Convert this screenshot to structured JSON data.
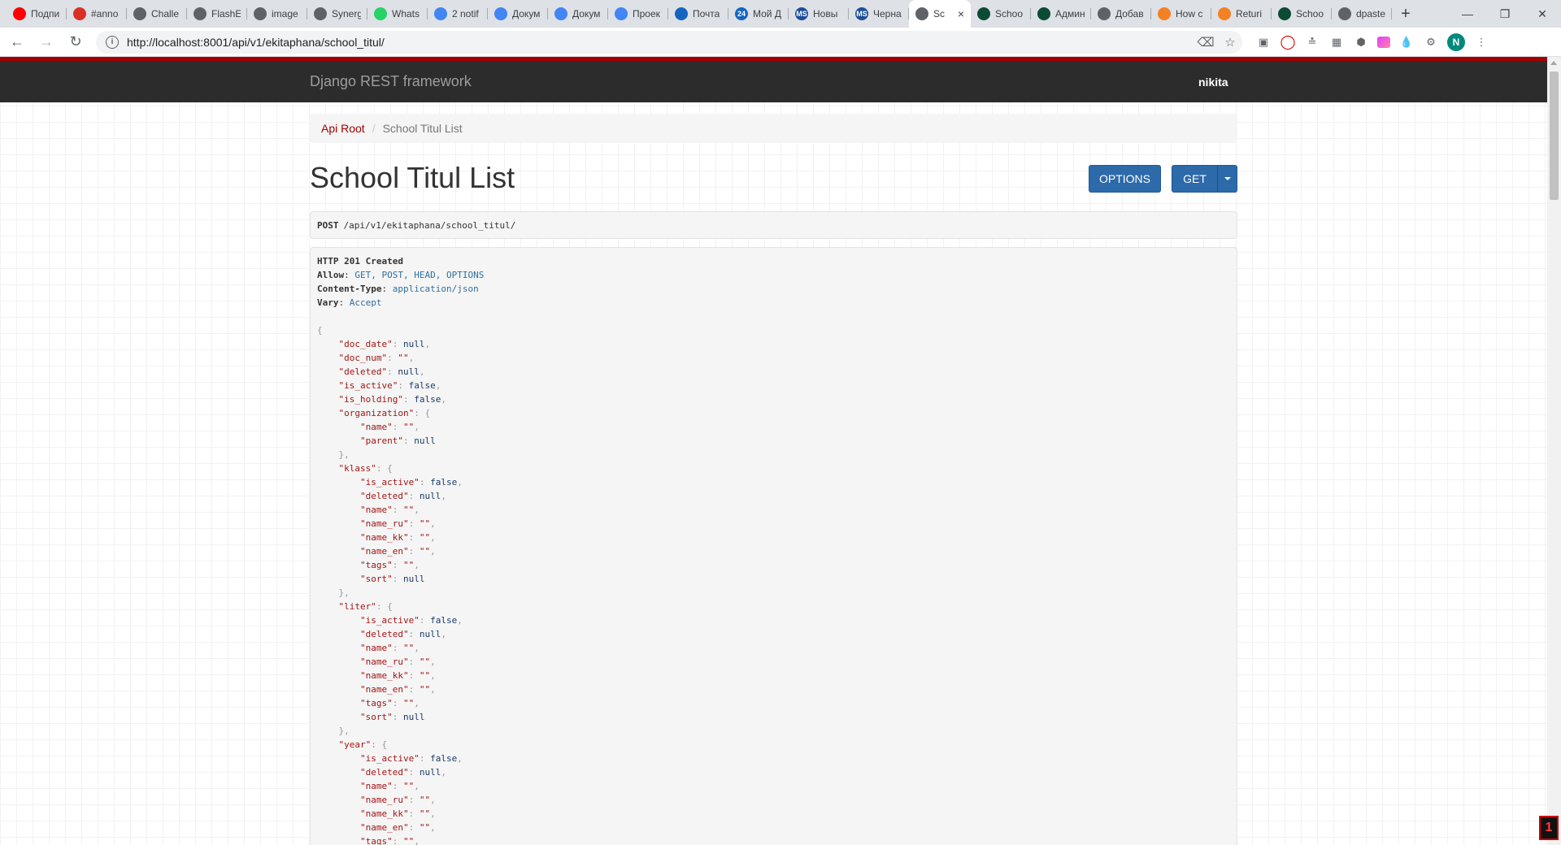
{
  "browser": {
    "tabs": [
      {
        "title": "Подпи",
        "favicon": "youtube-icon",
        "color": "#ff0000"
      },
      {
        "title": "#anno",
        "favicon": "gmail-icon",
        "color": "#d93025"
      },
      {
        "title": "Challe",
        "favicon": "globe-icon",
        "color": "#5f6368"
      },
      {
        "title": "FlashE",
        "favicon": "globe-icon",
        "color": "#5f6368"
      },
      {
        "title": "image",
        "favicon": "globe-icon",
        "color": "#5f6368"
      },
      {
        "title": "Synerg",
        "favicon": "globe-icon",
        "color": "#5f6368"
      },
      {
        "title": "Whats",
        "favicon": "whatsapp-icon",
        "color": "#25d366"
      },
      {
        "title": "2 notif",
        "favicon": "chat-icon",
        "color": "#4285f4"
      },
      {
        "title": "Докум",
        "favicon": "docs-icon",
        "color": "#4285f4"
      },
      {
        "title": "Докум",
        "favicon": "docs-icon",
        "color": "#4285f4"
      },
      {
        "title": "Проек",
        "favicon": "docs-icon",
        "color": "#4285f4"
      },
      {
        "title": "Почта",
        "favicon": "mail-icon",
        "color": "#1565c0"
      },
      {
        "title": "Мой Д",
        "favicon": "calendar-icon",
        "color": "#1565c0",
        "badge": "24"
      },
      {
        "title": "Новы",
        "favicon": "ms-icon",
        "color": "#1e4e9a",
        "badge": "MS"
      },
      {
        "title": "Черна",
        "favicon": "ms-icon",
        "color": "#1e4e9a",
        "badge": "MS"
      },
      {
        "title": "Sc",
        "favicon": "globe-icon",
        "color": "#5f6368",
        "active": true
      },
      {
        "title": "Schoo",
        "favicon": "django-icon",
        "color": "#0c4b33"
      },
      {
        "title": "Админ",
        "favicon": "django-icon",
        "color": "#0c4b33"
      },
      {
        "title": "Добав",
        "favicon": "globe-icon",
        "color": "#5f6368"
      },
      {
        "title": "How c",
        "favicon": "stackoverflow-icon",
        "color": "#f48024"
      },
      {
        "title": "Returi",
        "favicon": "stackoverflow-icon",
        "color": "#f48024"
      },
      {
        "title": "Schoo",
        "favicon": "django-icon",
        "color": "#0c4b33"
      },
      {
        "title": "dpaste",
        "favicon": "globe-icon",
        "color": "#5f6368"
      }
    ],
    "new_tab_label": "+",
    "url": "http://localhost:8001/api/v1/ekitaphana/school_titul/",
    "avatar_letter": "N",
    "corner_badge": "1"
  },
  "navbar": {
    "brand": "Django REST framework",
    "user": "nikita"
  },
  "breadcrumb": {
    "root": "Api Root",
    "current": "School Titul List"
  },
  "page": {
    "title": "School Titul List",
    "options_label": "OPTIONS",
    "get_label": "GET"
  },
  "request": {
    "method": "POST",
    "path": "/api/v1/ekitaphana/school_titul/"
  },
  "response": {
    "status": "HTTP 201 Created",
    "headers": [
      {
        "key": "Allow",
        "value": "GET, POST, HEAD, OPTIONS"
      },
      {
        "key": "Content-Type",
        "value": "application/json"
      },
      {
        "key": "Vary",
        "value": "Accept"
      }
    ],
    "body_lines": [
      [
        0,
        "{",
        "",
        ""
      ],
      [
        1,
        "\"doc_date\"",
        "null",
        ","
      ],
      [
        1,
        "\"doc_num\"",
        "\"\"",
        ","
      ],
      [
        1,
        "\"deleted\"",
        "null",
        ","
      ],
      [
        1,
        "\"is_active\"",
        "false",
        ","
      ],
      [
        1,
        "\"is_holding\"",
        "false",
        ","
      ],
      [
        1,
        "\"organization\"",
        "{",
        ""
      ],
      [
        2,
        "\"name\"",
        "\"\"",
        ","
      ],
      [
        2,
        "\"parent\"",
        "null",
        ""
      ],
      [
        1,
        "},",
        "",
        ""
      ],
      [
        1,
        "\"klass\"",
        "{",
        ""
      ],
      [
        2,
        "\"is_active\"",
        "false",
        ","
      ],
      [
        2,
        "\"deleted\"",
        "null",
        ","
      ],
      [
        2,
        "\"name\"",
        "\"\"",
        ","
      ],
      [
        2,
        "\"name_ru\"",
        "\"\"",
        ","
      ],
      [
        2,
        "\"name_kk\"",
        "\"\"",
        ","
      ],
      [
        2,
        "\"name_en\"",
        "\"\"",
        ","
      ],
      [
        2,
        "\"tags\"",
        "\"\"",
        ","
      ],
      [
        2,
        "\"sort\"",
        "null",
        ""
      ],
      [
        1,
        "},",
        "",
        ""
      ],
      [
        1,
        "\"liter\"",
        "{",
        ""
      ],
      [
        2,
        "\"is_active\"",
        "false",
        ","
      ],
      [
        2,
        "\"deleted\"",
        "null",
        ","
      ],
      [
        2,
        "\"name\"",
        "\"\"",
        ","
      ],
      [
        2,
        "\"name_ru\"",
        "\"\"",
        ","
      ],
      [
        2,
        "\"name_kk\"",
        "\"\"",
        ","
      ],
      [
        2,
        "\"name_en\"",
        "\"\"",
        ","
      ],
      [
        2,
        "\"tags\"",
        "\"\"",
        ","
      ],
      [
        2,
        "\"sort\"",
        "null",
        ""
      ],
      [
        1,
        "},",
        "",
        ""
      ],
      [
        1,
        "\"year\"",
        "{",
        ""
      ],
      [
        2,
        "\"is_active\"",
        "false",
        ","
      ],
      [
        2,
        "\"deleted\"",
        "null",
        ","
      ],
      [
        2,
        "\"name\"",
        "\"\"",
        ","
      ],
      [
        2,
        "\"name_ru\"",
        "\"\"",
        ","
      ],
      [
        2,
        "\"name_kk\"",
        "\"\"",
        ","
      ],
      [
        2,
        "\"name_en\"",
        "\"\"",
        ","
      ],
      [
        2,
        "\"tags\"",
        "\"\"",
        ","
      ]
    ]
  },
  "colors": {
    "navbar_bg": "#2c2c2c",
    "navbar_accent": "#a30000",
    "button_blue": "#2c6aaa",
    "link_red": "#a30000"
  }
}
